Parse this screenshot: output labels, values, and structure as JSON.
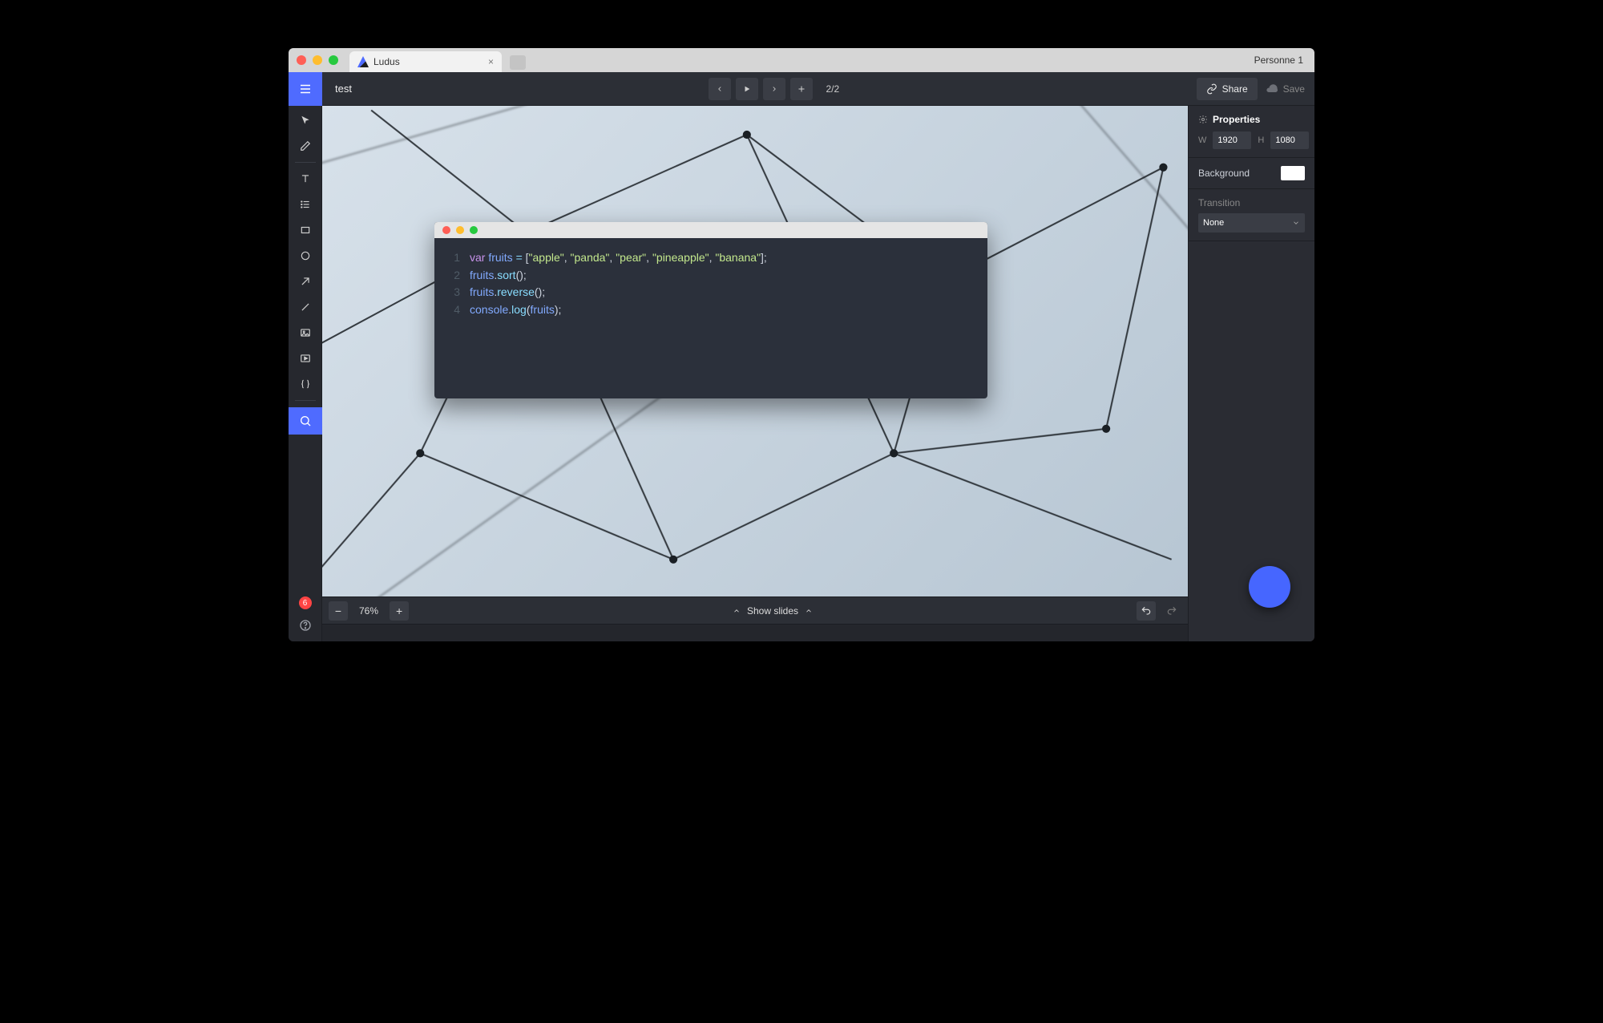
{
  "browser": {
    "tab_title": "Ludus",
    "user_label": "Personne 1"
  },
  "header": {
    "doc_title": "test",
    "page_counter": "2/2",
    "share_label": "Share",
    "save_label": "Save"
  },
  "canvas": {
    "zoom_label": "76%",
    "show_slides_label": "Show slides",
    "notification_count": "6"
  },
  "properties": {
    "title": "Properties",
    "width_label": "W",
    "width_value": "1920",
    "height_label": "H",
    "height_value": "1080",
    "background_label": "Background",
    "background_color": "#ffffff",
    "transition_label": "Transition",
    "transition_value": "None"
  },
  "code": {
    "lines": [
      "var fruits = [\"apple\", \"panda\", \"pear\", \"pineapple\", \"banana\"];",
      "fruits.sort();",
      "fruits.reverse();",
      "console.log(fruits);"
    ]
  }
}
